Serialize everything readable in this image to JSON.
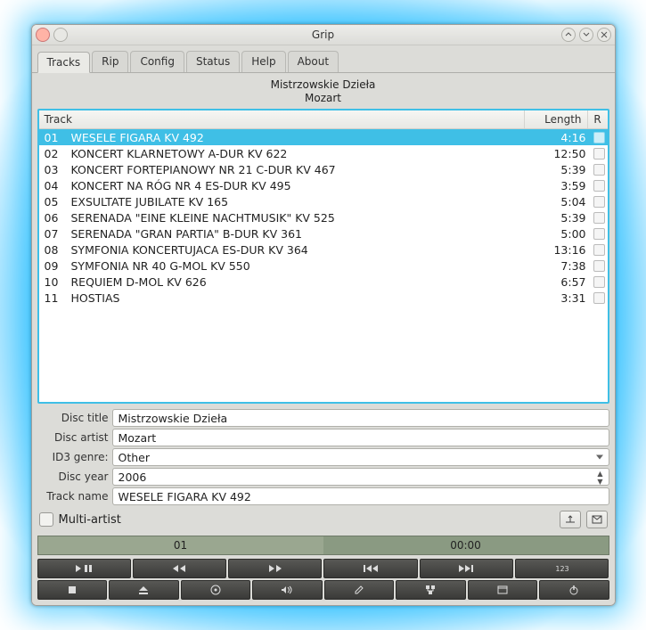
{
  "window": {
    "title": "Grip"
  },
  "tabs": [
    "Tracks",
    "Rip",
    "Config",
    "Status",
    "Help",
    "About"
  ],
  "active_tab": 0,
  "album": {
    "title": "Mistrzowskie Dzieła",
    "artist": "Mozart"
  },
  "columns": {
    "track": "Track",
    "length": "Length",
    "rip": "R"
  },
  "tracks": [
    {
      "num": "01",
      "title": "WESELE FIGARA KV 492",
      "length": "4:16",
      "selected": true
    },
    {
      "num": "02",
      "title": "KONCERT KLARNETOWY A-DUR KV 622",
      "length": "12:50"
    },
    {
      "num": "03",
      "title": "KONCERT FORTEPIANOWY NR 21 C-DUR KV 467",
      "length": "5:39"
    },
    {
      "num": "04",
      "title": "KONCERT NA RÓG NR 4 ES-DUR KV 495",
      "length": "3:59"
    },
    {
      "num": "05",
      "title": "EXSULTATE JUBILATE KV 165",
      "length": "5:04"
    },
    {
      "num": "06",
      "title": "SERENADA \"EINE KLEINE NACHTMUSIK\" KV 525",
      "length": "5:39"
    },
    {
      "num": "07",
      "title": "SERENADA \"GRAN PARTIA\" B-DUR KV 361",
      "length": "5:00"
    },
    {
      "num": "08",
      "title": "SYMFONIA KONCERTUJACA ES-DUR KV 364",
      "length": "13:16"
    },
    {
      "num": "09",
      "title": "SYMFONIA NR 40 G-MOL KV 550",
      "length": "7:38"
    },
    {
      "num": "10",
      "title": "REQUIEM D-MOL KV 626",
      "length": "6:57"
    },
    {
      "num": "11",
      "title": "HOSTIAS",
      "length": "3:31"
    }
  ],
  "form": {
    "disc_title_label": "Disc title",
    "disc_title": "Mistrzowskie Dzieła",
    "disc_artist_label": "Disc artist",
    "disc_artist": "Mozart",
    "genre_label": "ID3 genre:",
    "genre": "Other",
    "year_label": "Disc year",
    "year": "2006",
    "track_name_label": "Track name",
    "track_name": "WESELE FIGARA KV 492",
    "multi_artist_label": "Multi-artist"
  },
  "player": {
    "current_track": "01",
    "time": "00:00"
  },
  "toolbar_icons": {
    "row1": [
      "play-pause-icon",
      "rewind-icon",
      "fast-forward-icon",
      "prev-track-icon",
      "next-track-icon",
      "counter-icon"
    ],
    "row2": [
      "stop-icon",
      "eject-icon",
      "disc-icon",
      "volume-icon",
      "edit-icon",
      "database-icon",
      "window-icon",
      "power-icon"
    ]
  }
}
